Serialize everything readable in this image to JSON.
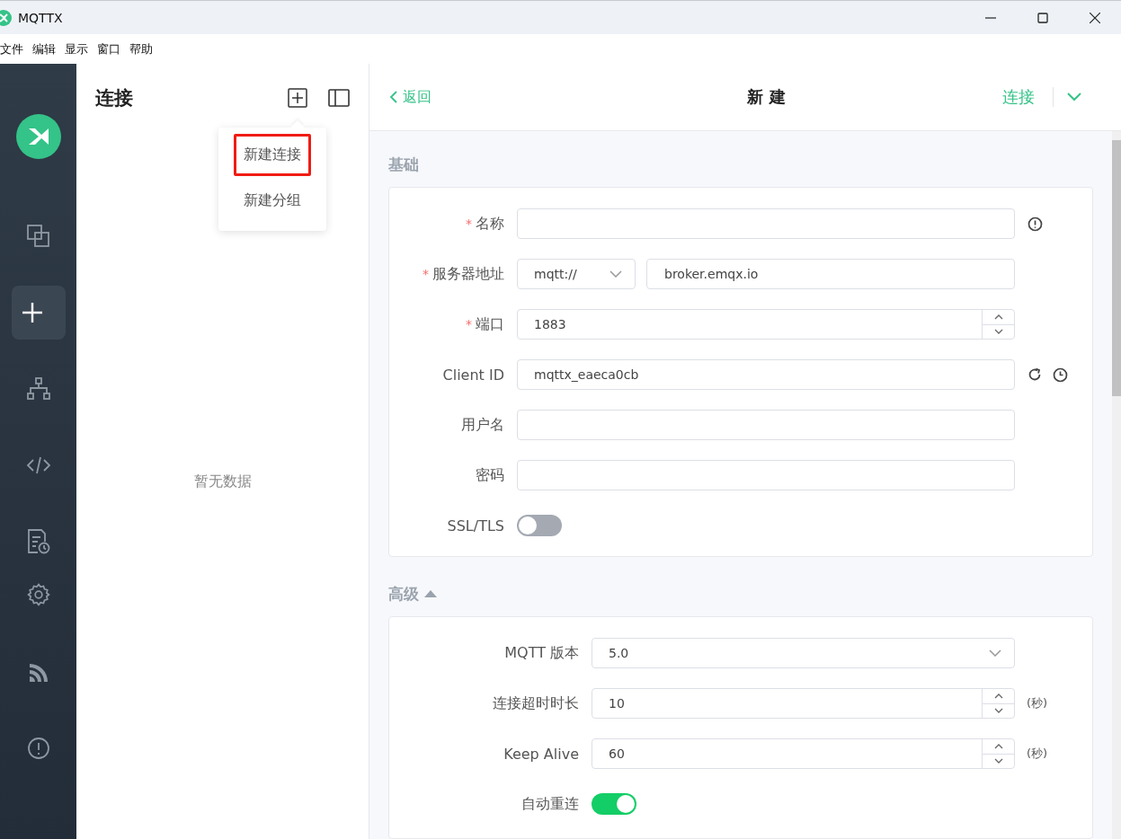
{
  "window": {
    "title": "MQTTX"
  },
  "menu": [
    "文件",
    "编辑",
    "显示",
    "窗口",
    "帮助"
  ],
  "sidebar": {
    "items": [
      {
        "kind": "copy",
        "selected": false
      },
      {
        "kind": "plus",
        "selected": true
      },
      {
        "kind": "tree",
        "selected": false
      },
      {
        "kind": "code",
        "selected": false
      },
      {
        "kind": "log",
        "selected": false
      },
      {
        "kind": "gear",
        "selected": false
      },
      {
        "kind": "rss",
        "selected": false
      },
      {
        "kind": "info",
        "selected": false
      }
    ]
  },
  "connections": {
    "title": "连接",
    "empty_text": "暂无数据",
    "menu": [
      {
        "label": "新建连接",
        "marked": true
      },
      {
        "label": "新建分组",
        "marked": false
      }
    ]
  },
  "header": {
    "back": "返回",
    "title": "新 建",
    "connect": "连接"
  },
  "basic": {
    "title": "基础",
    "fields": [
      {
        "kind": "info",
        "label": "名称",
        "required_mark": "*"
      },
      {
        "kind": "address",
        "label": "服务器地址",
        "required_mark": "*",
        "protocol": "mqtt://",
        "value": "broker.emqx.io"
      },
      {
        "kind": "number",
        "label": "端口",
        "required_mark": "*",
        "value": "1883"
      },
      {
        "kind": "clientid",
        "label": "Client ID",
        "value": "mqttx_eaeca0cb"
      },
      {
        "kind": "text",
        "label": "用户名"
      },
      {
        "kind": "text",
        "label": "密码"
      },
      {
        "kind": "switch",
        "label": "SSL/TLS",
        "on": false
      }
    ]
  },
  "advanced": {
    "title": "高级",
    "expanded": true,
    "fields": [
      {
        "kind": "select",
        "label": "MQTT 版本",
        "value": "5.0"
      },
      {
        "kind": "number",
        "label": "连接超时时长",
        "value": "10",
        "unit": "(秒)"
      },
      {
        "kind": "number",
        "label": "Keep Alive",
        "value": "60",
        "unit": "(秒)"
      },
      {
        "kind": "switch",
        "label": "自动重连",
        "on": true
      }
    ]
  }
}
